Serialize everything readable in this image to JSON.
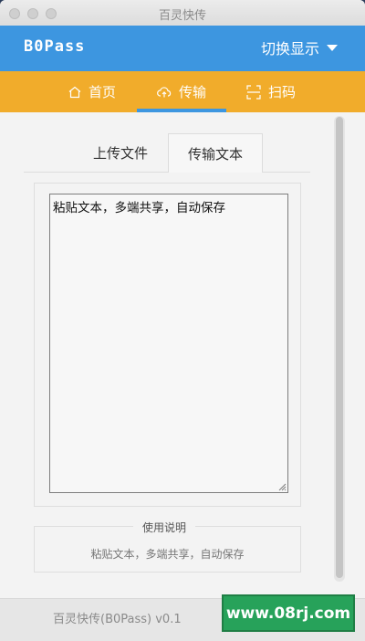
{
  "window": {
    "title": "百灵快传"
  },
  "header": {
    "brand": "B0Pass",
    "switch_label": "切换显示"
  },
  "nav": {
    "items": [
      {
        "label": "首页",
        "icon": "home-icon"
      },
      {
        "label": "传输",
        "icon": "cloud-upload-icon",
        "active": true
      },
      {
        "label": "扫码",
        "icon": "scan-icon"
      }
    ]
  },
  "tabs": [
    {
      "label": "上传文件"
    },
    {
      "label": "传输文本",
      "active": true
    }
  ],
  "textarea": {
    "value": "粘贴文本，多端共享，自动保存"
  },
  "instructions": {
    "legend": "使用说明",
    "text": "粘贴文本，多端共享，自动保存"
  },
  "footer": {
    "text": "百灵快传(B0Pass) v0.1"
  },
  "watermark": {
    "text": "www.08rj.com"
  },
  "colors": {
    "header_blue": "#3d96e0",
    "nav_orange": "#f1ac2b",
    "watermark_green": "#27a25a"
  }
}
